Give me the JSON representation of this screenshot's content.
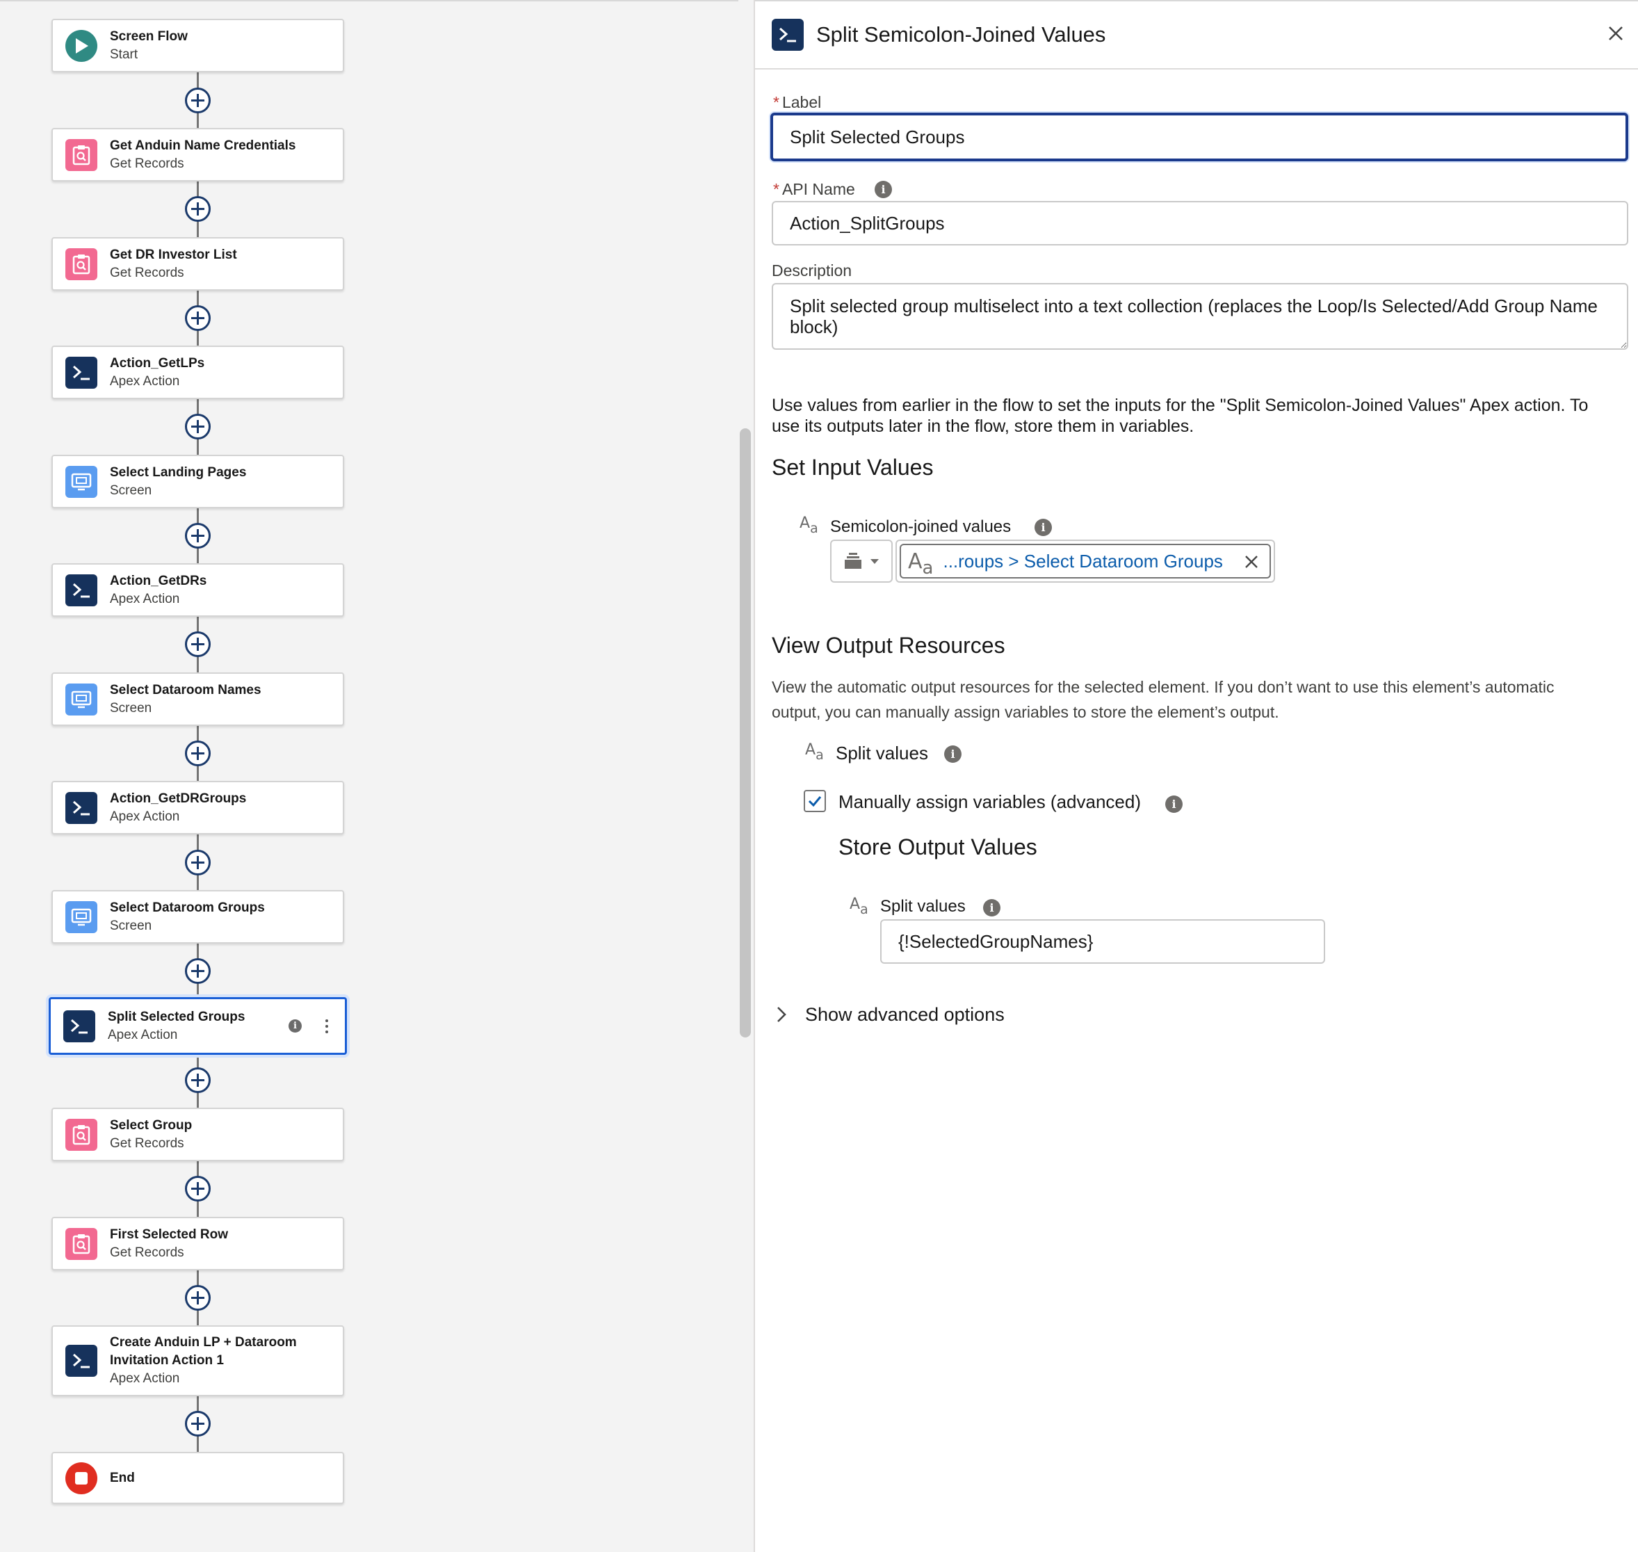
{
  "flow": {
    "nodes": [
      {
        "title": "Screen Flow",
        "subtitle": "Start",
        "type": "start",
        "icon": "play-icon"
      },
      {
        "title": "Get Anduin Name Credentials",
        "subtitle": "Get Records",
        "type": "records",
        "icon": "get-records-icon"
      },
      {
        "title": "Get DR Investor List",
        "subtitle": "Get Records",
        "type": "records",
        "icon": "get-records-icon"
      },
      {
        "title": "Action_GetLPs",
        "subtitle": "Apex Action",
        "type": "apex",
        "icon": "apex-action-icon"
      },
      {
        "title": "Select Landing Pages",
        "subtitle": "Screen",
        "type": "screen",
        "icon": "screen-icon"
      },
      {
        "title": "Action_GetDRs",
        "subtitle": "Apex Action",
        "type": "apex",
        "icon": "apex-action-icon"
      },
      {
        "title": "Select Dataroom Names",
        "subtitle": "Screen",
        "type": "screen",
        "icon": "screen-icon"
      },
      {
        "title": "Action_GetDRGroups",
        "subtitle": "Apex Action",
        "type": "apex",
        "icon": "apex-action-icon"
      },
      {
        "title": "Select Dataroom Groups",
        "subtitle": "Screen",
        "type": "screen",
        "icon": "screen-icon"
      },
      {
        "title": "Split Selected Groups",
        "subtitle": "Apex Action",
        "type": "apex",
        "icon": "apex-action-icon",
        "selected": true
      },
      {
        "title": "Select Group",
        "subtitle": "Get Records",
        "type": "records",
        "icon": "get-records-icon"
      },
      {
        "title": "First Selected Row",
        "subtitle": "Get Records",
        "type": "records",
        "icon": "get-records-icon"
      },
      {
        "title": "Create Anduin LP + Dataroom",
        "title_line2": "Invitation Action 1",
        "subtitle": "Apex Action",
        "type": "apex",
        "icon": "apex-action-icon"
      },
      {
        "title": "End",
        "subtitle": "",
        "type": "end",
        "icon": "stop-icon"
      }
    ]
  },
  "panel": {
    "title": "Split Semicolon-Joined Values",
    "label_field": {
      "label": "Label",
      "required_mark": "*",
      "value": "Split Selected Groups"
    },
    "api_name_field": {
      "label": "API Name",
      "required_mark": "*",
      "value": "Action_SplitGroups"
    },
    "description_field": {
      "label": "Description",
      "value": "Split selected group multiselect into a text collection (replaces the Loop/Is Selected/Add Group Name block)"
    },
    "intro_text": "Use values from earlier in the flow to set the inputs for the \"Split Semicolon-Joined Values\" Apex action. To use its outputs later in the flow, store them in variables.",
    "set_input_title": "Set Input Values",
    "input_param": {
      "label": "Semicolon-joined values",
      "resource_value": "...roups > Select Dataroom Groups"
    },
    "view_output_title": "View Output Resources",
    "output_text": "View the automatic output resources for the selected element. If you don’t want to use this element’s automatic output, you can manually assign variables to store the element’s output.",
    "output_param_label": "Split values",
    "manual_assign": {
      "label": "Manually assign variables (advanced)",
      "checked": true
    },
    "store_output_title": "Store Output Values",
    "store_param": {
      "label": "Split values",
      "value": "{!SelectedGroupNames}"
    },
    "advanced_options_label": "Show advanced options"
  },
  "type_icon_text": {
    "big": "A",
    "small": "a"
  },
  "colors": {
    "apex": "#16325c",
    "records": "#f26991",
    "screen": "#5a9cf0",
    "start": "#2f8a83",
    "end": "#e02d20",
    "link": "#0b5cab",
    "focus": "#1b3a8c"
  }
}
